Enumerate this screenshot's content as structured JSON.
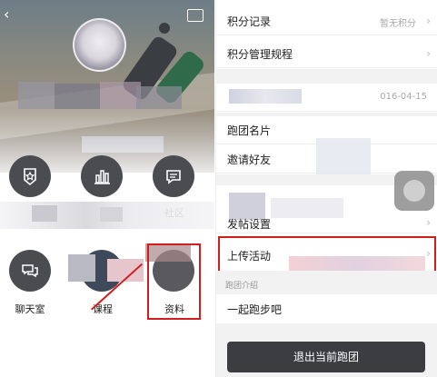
{
  "left": {
    "menu": [
      {
        "label": "",
        "icon": "badge-icon"
      },
      {
        "label": "",
        "icon": "chart-icon"
      },
      {
        "label": "社区",
        "icon": "message-icon"
      },
      {
        "label": "聊天室",
        "icon": "chat-icon"
      },
      {
        "label": "课程",
        "icon": ""
      },
      {
        "label": "资料",
        "icon": ""
      }
    ],
    "back_icon": "chevron-left-icon",
    "sign_icon": "sign-icon"
  },
  "right": {
    "rows": [
      {
        "label": "积分记录",
        "value": "暂无积分"
      },
      {
        "label": "积分管理规程",
        "value": ""
      },
      {
        "label": "",
        "value": "016-04-15"
      },
      {
        "label": "跑团名片",
        "value": ""
      },
      {
        "label": "邀请好友",
        "value": ""
      },
      {
        "label": "发帖设置",
        "value": ""
      },
      {
        "label": "上传活动",
        "value": ""
      }
    ],
    "intro_label": "跑团介绍",
    "intro_text": "一起跑步吧",
    "exit_label": "退出当前跑团"
  },
  "colors": {
    "accent": "#d21d1d",
    "icon_bg": "#4a4c50",
    "exit_bg": "#3c3d40"
  }
}
